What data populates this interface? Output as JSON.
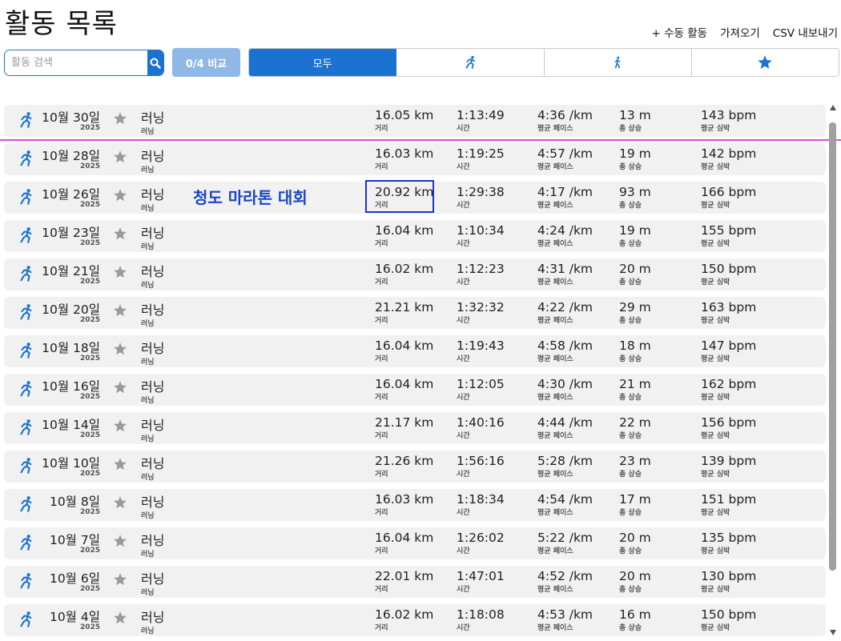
{
  "header": {
    "title": "활동 목록",
    "links": [
      "+ 수동 활동",
      "가져오기",
      "CSV 내보내기"
    ]
  },
  "search": {
    "placeholder": "활동 검색",
    "value": ""
  },
  "compare_label": "0/4 비교",
  "filters": [
    {
      "label": "모두",
      "icon": "",
      "active": true
    },
    {
      "label": "",
      "icon": "running-icon",
      "active": false
    },
    {
      "label": "",
      "icon": "walking-icon",
      "active": false
    },
    {
      "label": "",
      "icon": "star-icon",
      "active": false
    }
  ],
  "stat_labels": {
    "distance": "거리",
    "time": "시간",
    "pace": "평균 페이스",
    "elevation": "총 상승",
    "heart_rate": "평균 심박"
  },
  "colors": {
    "accent": "#1a73d1",
    "title_highlight": "#1846c8",
    "divider": "#d94cd9"
  },
  "activities": [
    {
      "date": "10월 30일",
      "year": "2025",
      "name": "러닝",
      "type": "러닝",
      "title": "",
      "distance": "16.05 km",
      "time": "1:13:49",
      "pace": "4:36 /km",
      "elevation": "13 m",
      "heart_rate": "143 bpm"
    },
    {
      "date": "10월 28일",
      "year": "2025",
      "name": "러닝",
      "type": "러닝",
      "title": "",
      "distance": "16.03 km",
      "time": "1:19:25",
      "pace": "4:57 /km",
      "elevation": "19 m",
      "heart_rate": "142 bpm"
    },
    {
      "date": "10월 26일",
      "year": "2025",
      "name": "러닝",
      "type": "러닝",
      "title": "청도 마라톤 대회",
      "distance": "20.92 km",
      "time": "1:29:38",
      "pace": "4:17 /km",
      "elevation": "93 m",
      "heart_rate": "166 bpm"
    },
    {
      "date": "10월 23일",
      "year": "2025",
      "name": "러닝",
      "type": "러닝",
      "title": "",
      "distance": "16.04 km",
      "time": "1:10:34",
      "pace": "4:24 /km",
      "elevation": "19 m",
      "heart_rate": "155 bpm"
    },
    {
      "date": "10월 21일",
      "year": "2025",
      "name": "러닝",
      "type": "러닝",
      "title": "",
      "distance": "16.02 km",
      "time": "1:12:23",
      "pace": "4:31 /km",
      "elevation": "20 m",
      "heart_rate": "150 bpm"
    },
    {
      "date": "10월 20일",
      "year": "2025",
      "name": "러닝",
      "type": "러닝",
      "title": "",
      "distance": "21.21 km",
      "time": "1:32:32",
      "pace": "4:22 /km",
      "elevation": "29 m",
      "heart_rate": "163 bpm"
    },
    {
      "date": "10월 18일",
      "year": "2025",
      "name": "러닝",
      "type": "러닝",
      "title": "",
      "distance": "16.04 km",
      "time": "1:19:43",
      "pace": "4:58 /km",
      "elevation": "18 m",
      "heart_rate": "147 bpm"
    },
    {
      "date": "10월 16일",
      "year": "2025",
      "name": "러닝",
      "type": "러닝",
      "title": "",
      "distance": "16.04 km",
      "time": "1:12:05",
      "pace": "4:30 /km",
      "elevation": "21 m",
      "heart_rate": "162 bpm"
    },
    {
      "date": "10월 14일",
      "year": "2025",
      "name": "러닝",
      "type": "러닝",
      "title": "",
      "distance": "21.17 km",
      "time": "1:40:16",
      "pace": "4:44 /km",
      "elevation": "22 m",
      "heart_rate": "156 bpm"
    },
    {
      "date": "10월 10일",
      "year": "2025",
      "name": "러닝",
      "type": "러닝",
      "title": "",
      "distance": "21.26 km",
      "time": "1:56:16",
      "pace": "5:28 /km",
      "elevation": "23 m",
      "heart_rate": "139 bpm"
    },
    {
      "date": "10월 8일",
      "year": "2025",
      "name": "러닝",
      "type": "러닝",
      "title": "",
      "distance": "16.03 km",
      "time": "1:18:34",
      "pace": "4:54 /km",
      "elevation": "17 m",
      "heart_rate": "151 bpm"
    },
    {
      "date": "10월 7일",
      "year": "2025",
      "name": "러닝",
      "type": "러닝",
      "title": "",
      "distance": "16.04 km",
      "time": "1:26:02",
      "pace": "5:22 /km",
      "elevation": "20 m",
      "heart_rate": "135 bpm"
    },
    {
      "date": "10월 6일",
      "year": "2025",
      "name": "러닝",
      "type": "러닝",
      "title": "",
      "distance": "22.01 km",
      "time": "1:47:01",
      "pace": "4:52 /km",
      "elevation": "20 m",
      "heart_rate": "130 bpm"
    },
    {
      "date": "10월 4일",
      "year": "2025",
      "name": "러닝",
      "type": "러닝",
      "title": "",
      "distance": "16.02 km",
      "time": "1:18:08",
      "pace": "4:53 /km",
      "elevation": "16 m",
      "heart_rate": "150 bpm"
    }
  ]
}
